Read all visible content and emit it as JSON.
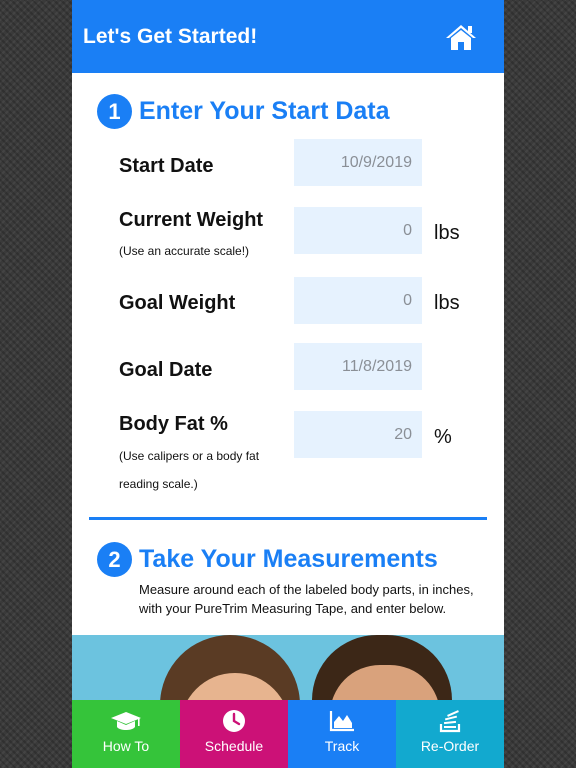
{
  "header": {
    "title": "Let's Get Started!",
    "home_icon": "home-icon"
  },
  "section1": {
    "number": "1",
    "title": "Enter Your Start Data",
    "fields": {
      "start_date": {
        "label": "Start Date",
        "value": "10/9/2019"
      },
      "current_weight": {
        "label": "Current Weight",
        "note": "(Use an accurate scale!)",
        "value": "0",
        "unit": "lbs"
      },
      "goal_weight": {
        "label": "Goal Weight",
        "value": "0",
        "unit": "lbs"
      },
      "goal_date": {
        "label": "Goal Date",
        "value": "11/8/2019"
      },
      "body_fat": {
        "label": "Body Fat %",
        "note_line1": "(Use calipers or a body fat",
        "note_line2": "reading scale.)",
        "value": "20",
        "unit": "%"
      }
    }
  },
  "section2": {
    "number": "2",
    "title": "Take Your Measurements",
    "description": "Measure around each of the labeled body parts, in inches, with your PureTrim Measuring Tape, and enter below."
  },
  "nav": [
    {
      "label": "How To",
      "icon": "graduation-cap-icon",
      "color": "#35c43a"
    },
    {
      "label": "Schedule",
      "icon": "clock-icon",
      "color": "#cc1177"
    },
    {
      "label": "Track",
      "icon": "area-chart-icon",
      "color": "#1a7ff5"
    },
    {
      "label": "Re-Order",
      "icon": "stack-icon",
      "color": "#12a9cf"
    }
  ],
  "colors": {
    "accent": "#1a7ff5",
    "input_bg": "#e6f2fe"
  }
}
